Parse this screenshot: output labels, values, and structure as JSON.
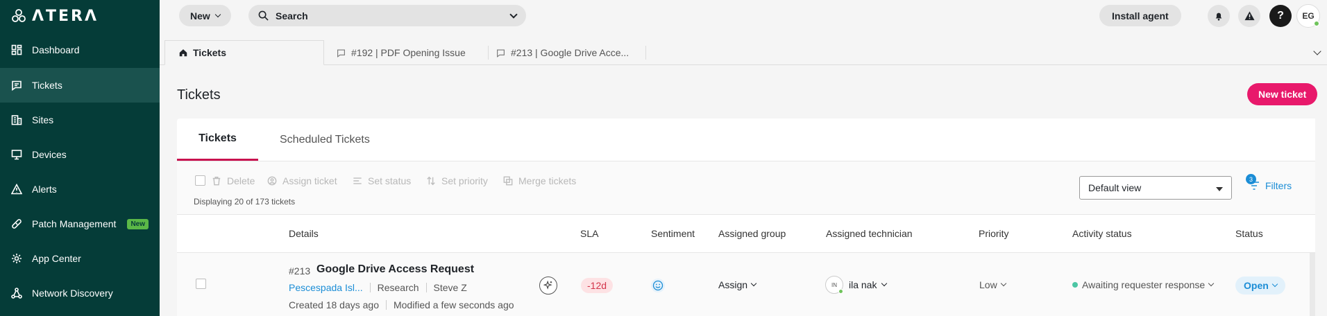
{
  "app": {
    "logo_text": "ΛTERΛ"
  },
  "sidebar": {
    "items": [
      {
        "label": "Dashboard",
        "icon": "dashboard-icon"
      },
      {
        "label": "Tickets",
        "icon": "ticket-icon",
        "active": true
      },
      {
        "label": "Sites",
        "icon": "building-icon"
      },
      {
        "label": "Devices",
        "icon": "monitor-icon"
      },
      {
        "label": "Alerts",
        "icon": "alert-icon"
      },
      {
        "label": "Patch Management",
        "icon": "bandage-icon",
        "badge": "New"
      },
      {
        "label": "App Center",
        "icon": "gear-icon"
      },
      {
        "label": "Network Discovery",
        "icon": "network-icon"
      }
    ]
  },
  "topbar": {
    "new_label": "New",
    "search_placeholder": "Search",
    "install_label": "Install agent",
    "help_label": "?",
    "user_initials": "EG"
  },
  "window_tabs": [
    {
      "label": "Tickets",
      "icon": "home-icon"
    },
    {
      "label": "#192 | PDF Opening Issue",
      "icon": "ticket-icon"
    },
    {
      "label": "#213 | Google Drive Acce...",
      "icon": "ticket-icon"
    }
  ],
  "page": {
    "title": "Tickets",
    "new_ticket_label": "New ticket"
  },
  "panel_tabs": [
    {
      "label": "Tickets",
      "active": true
    },
    {
      "label": "Scheduled Tickets"
    }
  ],
  "actions": {
    "delete": "Delete",
    "assign": "Assign ticket",
    "set_status": "Set status",
    "set_priority": "Set priority",
    "merge": "Merge tickets",
    "displaying": "Displaying 20 of 173 tickets",
    "view": "Default view",
    "filters_label": "Filters",
    "filters_count": "3"
  },
  "table": {
    "columns": [
      "Details",
      "SLA",
      "Sentiment",
      "Assigned group",
      "Assigned technician",
      "Priority",
      "Activity status",
      "Status"
    ],
    "rows": [
      {
        "id": "#213",
        "title": "Google Drive Access Request",
        "site": "Pescespada Isl...",
        "department": "Research",
        "requester": "Steve Z",
        "created": "Created 18 days ago",
        "modified": "Modified a few seconds ago",
        "sla": "-12d",
        "group": "Assign",
        "tech_initials": "IN",
        "technician": "ila nak",
        "priority": "Low",
        "activity": "Awaiting requester response",
        "status": "Open"
      }
    ]
  },
  "colors": {
    "sidebar_bg": "#053c38",
    "accent_pink": "#e8196b",
    "link_blue": "#1b8dd6"
  }
}
